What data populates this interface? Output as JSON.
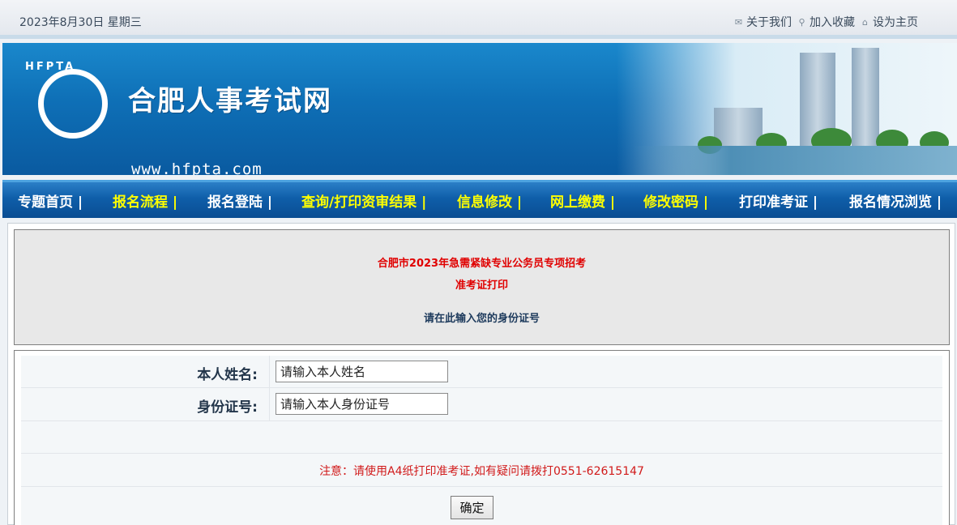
{
  "topbar": {
    "date": "2023年8月30日 星期三",
    "links": [
      {
        "icon": "mail-icon",
        "label": "关于我们"
      },
      {
        "icon": "search-icon",
        "label": "加入收藏"
      },
      {
        "icon": "home-icon",
        "label": "设为主页"
      }
    ]
  },
  "banner": {
    "logo_text": "HFPTA",
    "title": "合肥人事考试网",
    "url": "www.hfpta.com"
  },
  "nav": {
    "items": [
      {
        "label": "专题首页 |",
        "color": "#ffffff"
      },
      {
        "label": "报名流程 |",
        "color": "#ffff00"
      },
      {
        "label": "报名登陆 |",
        "color": "#ffffff"
      },
      {
        "label": "查询/打印资审结果 |",
        "color": "#ffff00"
      },
      {
        "label": "信息修改 |",
        "color": "#ffff00"
      },
      {
        "label": "网上缴费 |",
        "color": "#ffff00"
      },
      {
        "label": "修改密码 |",
        "color": "#ffff00"
      },
      {
        "label": "打印准考证 |",
        "color": "#ffffff"
      },
      {
        "label": "报名情况浏览 |",
        "color": "#ffffff"
      }
    ]
  },
  "notice": {
    "title": "合肥市2023年急需紧缺专业公务员专项招考",
    "subtitle": "准考证打印",
    "instruction": "请在此输入您的身份证号",
    "title_color": "#e00000",
    "instruction_color": "#1d3a5c"
  },
  "form": {
    "name_label": "本人姓名:",
    "name_placeholder": "请输入本人姓名",
    "id_label": "身份证号:",
    "id_placeholder": "请输入本人身份证号",
    "warning": "注意：请使用A4纸打印准考证,如有疑问请拨打0551-62615147",
    "submit_label": "确定"
  }
}
